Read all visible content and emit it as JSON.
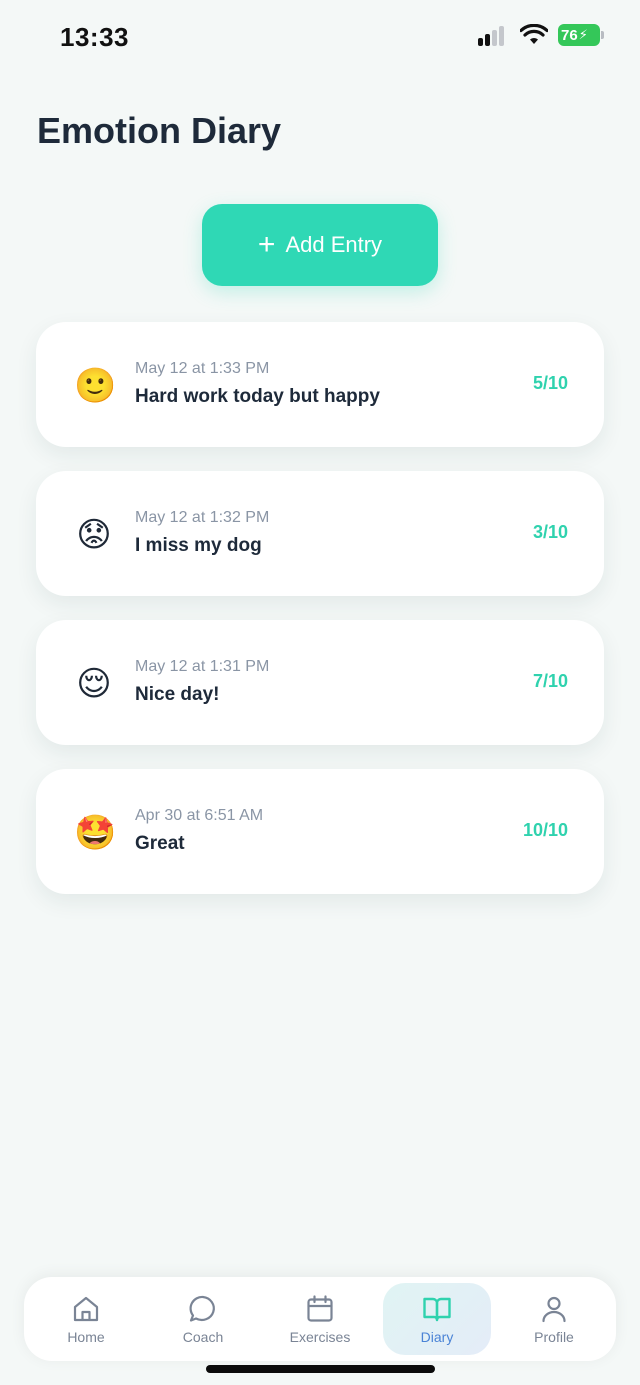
{
  "status": {
    "time": "13:33",
    "battery": "76"
  },
  "page": {
    "title": "Emotion Diary"
  },
  "actions": {
    "add_entry_label": "Add Entry"
  },
  "entries": [
    {
      "emoji": "🙂",
      "date": "May 12 at 1:33 PM",
      "text": "Hard work today but happy",
      "score": "5/10"
    },
    {
      "emoji": "😟",
      "date": "May 12 at 1:32 PM",
      "text": "I miss my dog",
      "score": "3/10"
    },
    {
      "emoji": "😌",
      "date": "May 12 at 1:31 PM",
      "text": "Nice day!",
      "score": "7/10"
    },
    {
      "emoji": "🤩",
      "date": "Apr 30 at 6:51 AM",
      "text": "Great",
      "score": "10/10"
    }
  ],
  "tabs": [
    {
      "label": "Home",
      "icon": "home-icon",
      "active": false
    },
    {
      "label": "Coach",
      "icon": "chat-bubble-icon",
      "active": false
    },
    {
      "label": "Exercises",
      "icon": "calendar-icon",
      "active": false
    },
    {
      "label": "Diary",
      "icon": "open-book-icon",
      "active": true
    },
    {
      "label": "Profile",
      "icon": "person-icon",
      "active": false
    }
  ],
  "colors": {
    "accent": "#2fd8b5",
    "active_tab_label": "#4a83d6",
    "battery": "#34c759"
  }
}
